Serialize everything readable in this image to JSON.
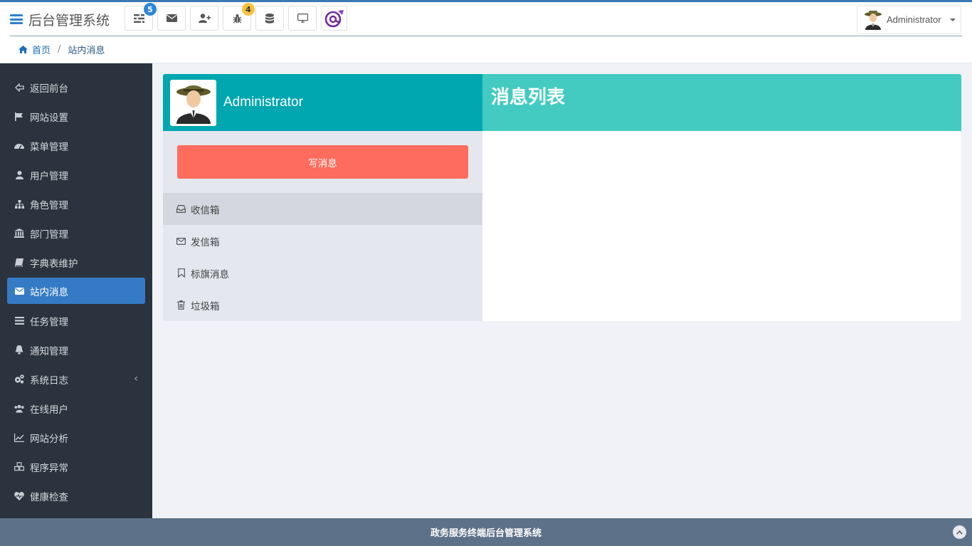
{
  "app": {
    "title": "后台管理系统"
  },
  "toolbar": {
    "items": [
      {
        "icon": "task-list-icon",
        "badge": "5"
      },
      {
        "icon": "envelope-icon",
        "badge": ""
      },
      {
        "icon": "add-user-icon",
        "badge": ""
      },
      {
        "icon": "bug-icon",
        "badge": "4"
      },
      {
        "icon": "database-icon",
        "badge": ""
      },
      {
        "icon": "monitor-icon",
        "badge": ""
      },
      {
        "icon": "blazor-logo-icon",
        "badge": ""
      }
    ]
  },
  "user": {
    "name": "Administrator"
  },
  "breadcrumb": {
    "home": "首页",
    "separator": "/",
    "current": "站内消息"
  },
  "sidebar": {
    "items": [
      {
        "label": "返回前台",
        "icon": "back-icon"
      },
      {
        "label": "网站设置",
        "icon": "flag-icon"
      },
      {
        "label": "菜单管理",
        "icon": "dashboard-icon"
      },
      {
        "label": "用户管理",
        "icon": "user-icon"
      },
      {
        "label": "角色管理",
        "icon": "sitemap-icon"
      },
      {
        "label": "部门管理",
        "icon": "bank-icon"
      },
      {
        "label": "字典表维护",
        "icon": "book-icon"
      },
      {
        "label": "站内消息",
        "icon": "envelope-icon",
        "active": true
      },
      {
        "label": "任务管理",
        "icon": "tasks-icon"
      },
      {
        "label": "通知管理",
        "icon": "bell-icon"
      },
      {
        "label": "系统日志",
        "icon": "cogs-icon",
        "expandable": true
      },
      {
        "label": "在线用户",
        "icon": "users-icon"
      },
      {
        "label": "网站分析",
        "icon": "line-chart-icon"
      },
      {
        "label": "程序异常",
        "icon": "cubes-icon"
      },
      {
        "label": "健康检查",
        "icon": "heartbeat-icon"
      }
    ]
  },
  "mail": {
    "profile_name": "Administrator",
    "compose_label": "写消息",
    "folders": [
      {
        "label": "收信箱",
        "icon": "inbox-icon",
        "active": true
      },
      {
        "label": "发信箱",
        "icon": "envelope-outline-icon"
      },
      {
        "label": "标旗消息",
        "icon": "bookmark-icon"
      },
      {
        "label": "垃圾箱",
        "icon": "trash-icon"
      }
    ],
    "list_title": "消息列表"
  },
  "footer": {
    "text": "政务服务终端后台管理系统"
  },
  "colors": {
    "accent": "#357ac4",
    "profile_bg": "#00a7b0",
    "list_header_bg": "#43cbc1",
    "compose_bg": "#fd6c5d",
    "sidebar_bg": "#2b333e",
    "footer_bg": "#5d7189"
  }
}
